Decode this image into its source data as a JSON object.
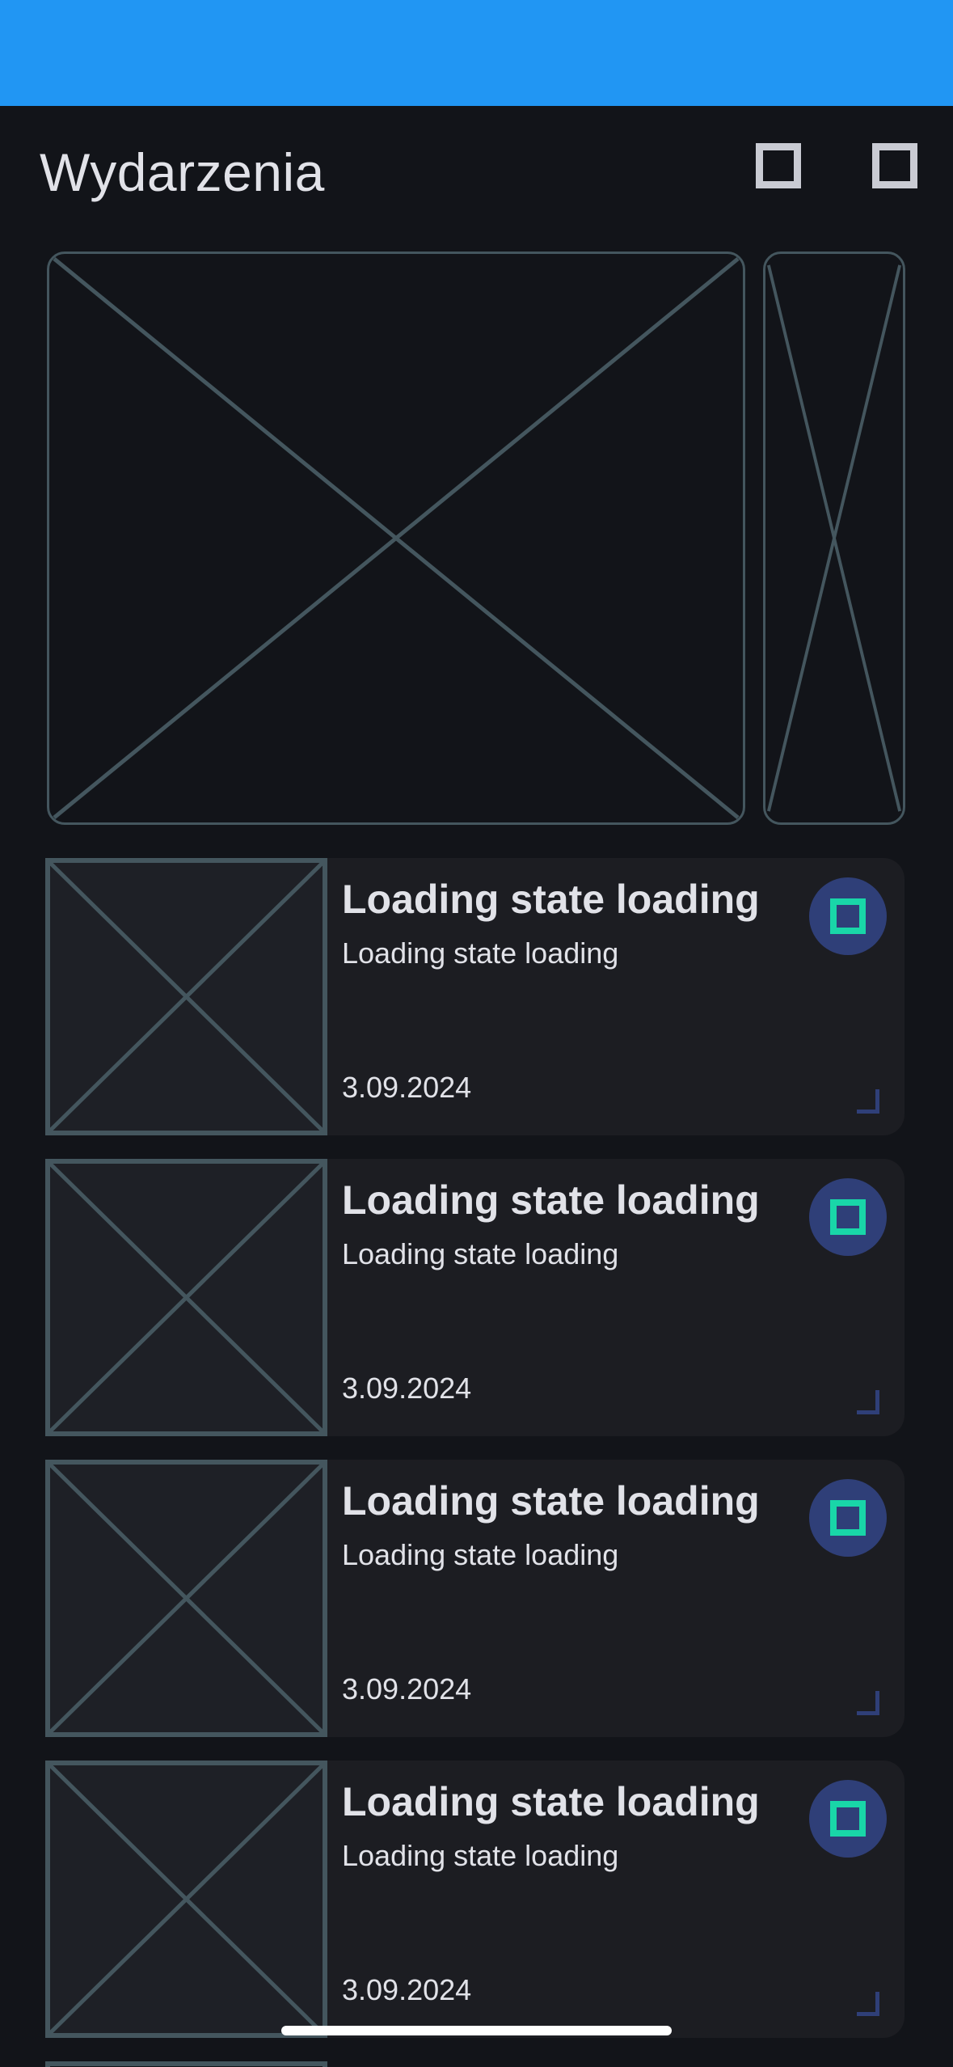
{
  "app_bar": {
    "title": "Wydarzenia",
    "actions": [
      {
        "icon": "square-outline-icon"
      },
      {
        "icon": "square-outline-icon"
      }
    ]
  },
  "carousel": {
    "items": [
      {
        "icon": "image-placeholder-icon"
      },
      {
        "icon": "image-placeholder-icon"
      }
    ]
  },
  "events": [
    {
      "title": "Loading state loading",
      "subtitle": "Loading state loading",
      "date": "3.09.2024"
    },
    {
      "title": "Loading state loading",
      "subtitle": "Loading state loading",
      "date": "3.09.2024"
    },
    {
      "title": "Loading state loading",
      "subtitle": "Loading state loading",
      "date": "3.09.2024"
    },
    {
      "title": "Loading state loading",
      "subtitle": "Loading state loading",
      "date": "3.09.2024"
    }
  ],
  "colors": {
    "status_bar": "#2196F3",
    "background": "#121419",
    "card": "#1C1D22",
    "placeholder_stroke": "#44565E",
    "fav_circle": "#2F3F78",
    "accent": "#19D6A8",
    "text": "#E1E2E8"
  }
}
